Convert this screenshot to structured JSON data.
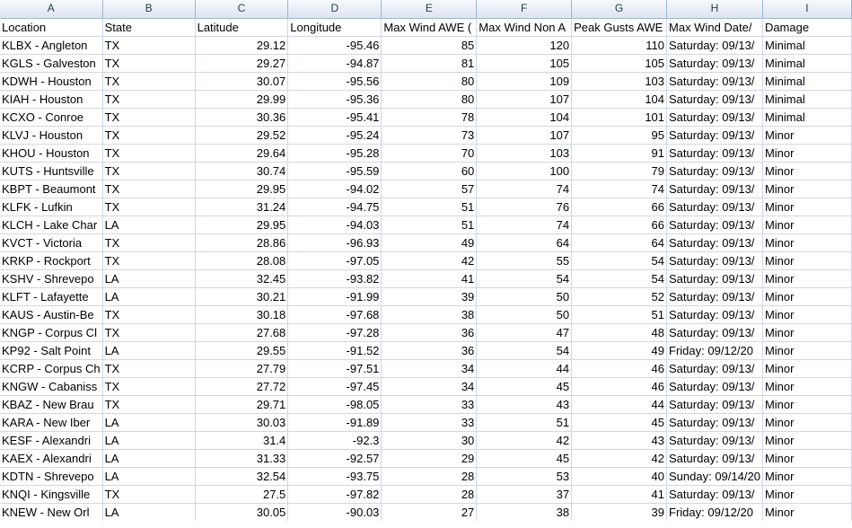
{
  "column_letters": [
    "A",
    "B",
    "C",
    "D",
    "E",
    "F",
    "G",
    "H",
    "I"
  ],
  "headers": [
    "Location",
    "State",
    "Latitude",
    "Longitude",
    "Max Wind AWE (",
    "Max Wind Non A",
    "Peak Gusts AWE",
    "Max Wind Date/",
    "Damage"
  ],
  "rows": [
    [
      "KLBX - Angleton",
      "TX",
      "29.12",
      "-95.46",
      "85",
      "120",
      "110",
      "Saturday: 09/13/",
      "Minimal"
    ],
    [
      "KGLS - Galveston",
      "TX",
      "29.27",
      "-94.87",
      "81",
      "105",
      "105",
      "Saturday: 09/13/",
      "Minimal"
    ],
    [
      "KDWH - Houston",
      "TX",
      "30.07",
      "-95.56",
      "80",
      "109",
      "103",
      "Saturday: 09/13/",
      "Minimal"
    ],
    [
      "KIAH - Houston",
      "TX",
      "29.99",
      "-95.36",
      "80",
      "107",
      "104",
      "Saturday: 09/13/",
      "Minimal"
    ],
    [
      "KCXO - Conroe",
      "TX",
      "30.36",
      "-95.41",
      "78",
      "104",
      "101",
      "Saturday: 09/13/",
      "Minimal"
    ],
    [
      "KLVJ - Houston",
      "TX",
      "29.52",
      "-95.24",
      "73",
      "107",
      "95",
      "Saturday: 09/13/",
      "Minor"
    ],
    [
      "KHOU - Houston",
      "TX",
      "29.64",
      "-95.28",
      "70",
      "103",
      "91",
      "Saturday: 09/13/",
      "Minor"
    ],
    [
      "KUTS - Huntsville",
      "TX",
      "30.74",
      "-95.59",
      "60",
      "100",
      "79",
      "Saturday: 09/13/",
      "Minor"
    ],
    [
      "KBPT - Beaumont",
      "TX",
      "29.95",
      "-94.02",
      "57",
      "74",
      "74",
      "Saturday: 09/13/",
      "Minor"
    ],
    [
      "KLFK - Lufkin",
      "TX",
      "31.24",
      "-94.75",
      "51",
      "76",
      "66",
      "Saturday: 09/13/",
      "Minor"
    ],
    [
      "KLCH - Lake Char",
      "LA",
      "29.95",
      "-94.03",
      "51",
      "74",
      "66",
      "Saturday: 09/13/",
      "Minor"
    ],
    [
      "KVCT - Victoria",
      "TX",
      "28.86",
      "-96.93",
      "49",
      "64",
      "64",
      "Saturday: 09/13/",
      "Minor"
    ],
    [
      "KRKP - Rockport",
      "TX",
      "28.08",
      "-97.05",
      "42",
      "55",
      "54",
      "Saturday: 09/13/",
      "Minor"
    ],
    [
      "KSHV - Shrevepo",
      "LA",
      "32.45",
      "-93.82",
      "41",
      "54",
      "54",
      "Saturday: 09/13/",
      "Minor"
    ],
    [
      "KLFT - Lafayette",
      "LA",
      "30.21",
      "-91.99",
      "39",
      "50",
      "52",
      "Saturday: 09/13/",
      "Minor"
    ],
    [
      "KAUS - Austin-Be",
      "TX",
      "30.18",
      "-97.68",
      "38",
      "50",
      "51",
      "Saturday: 09/13/",
      "Minor"
    ],
    [
      "KNGP - Corpus Cl",
      "TX",
      "27.68",
      "-97.28",
      "36",
      "47",
      "48",
      "Saturday: 09/13/",
      "Minor"
    ],
    [
      "KP92 - Salt Point",
      "LA",
      "29.55",
      "-91.52",
      "36",
      "54",
      "49",
      "Friday: 09/12/20",
      "Minor"
    ],
    [
      "KCRP - Corpus Ch",
      "TX",
      "27.79",
      "-97.51",
      "34",
      "44",
      "46",
      "Saturday: 09/13/",
      "Minor"
    ],
    [
      "KNGW - Cabaniss",
      "TX",
      "27.72",
      "-97.45",
      "34",
      "45",
      "46",
      "Saturday: 09/13/",
      "Minor"
    ],
    [
      "KBAZ - New Brau",
      "TX",
      "29.71",
      "-98.05",
      "33",
      "43",
      "44",
      "Saturday: 09/13/",
      "Minor"
    ],
    [
      "KARA - New Iber",
      "LA",
      "30.03",
      "-91.89",
      "33",
      "51",
      "45",
      "Saturday: 09/13/",
      "Minor"
    ],
    [
      "KESF - Alexandri",
      "LA",
      "31.4",
      "-92.3",
      "30",
      "42",
      "43",
      "Saturday: 09/13/",
      "Minor"
    ],
    [
      "KAEX - Alexandri",
      "LA",
      "31.33",
      "-92.57",
      "29",
      "45",
      "42",
      "Saturday: 09/13/",
      "Minor"
    ],
    [
      "KDTN - Shrevepo",
      "LA",
      "32.54",
      "-93.75",
      "28",
      "53",
      "40",
      "Sunday: 09/14/20",
      "Minor"
    ],
    [
      "KNQI - Kingsville",
      "TX",
      "27.5",
      "-97.82",
      "28",
      "37",
      "41",
      "Saturday: 09/13/",
      "Minor"
    ],
    [
      "KNEW - New Orl",
      "LA",
      "30.05",
      "-90.03",
      "27",
      "38",
      "39",
      "Friday: 09/12/20",
      "Minor"
    ]
  ]
}
